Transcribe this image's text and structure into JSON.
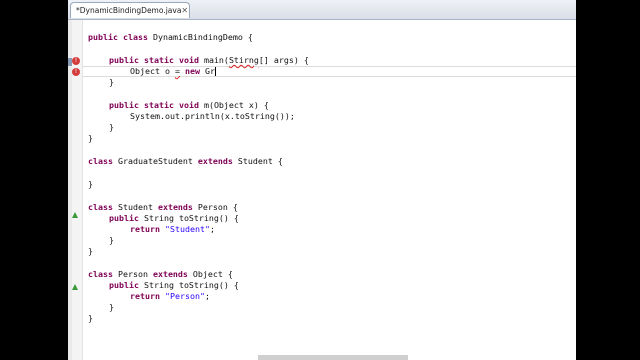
{
  "tab": {
    "title": "*DynamicBindingDemo.java",
    "close": "✕"
  },
  "code": {
    "l1": "public class DynamicBindingDemo {",
    "l3a": "public static void main(",
    "l3b": "Stirng",
    "l3c": "[] args) {",
    "l4a": "Object o ",
    "l4b": "=",
    "l4c": " new Gr",
    "l5": "}",
    "l7": "public static void m(Object x) {",
    "l8": "System.out.println(x.toString());",
    "l9": "}",
    "l10": "}",
    "l12": "class GraduateStudent extends Student {",
    "l14": "}",
    "l16": "class Student extends Person {",
    "l17": "public String toString() {",
    "l18": "return \"Student\";",
    "l19": "}",
    "l20": "}",
    "l22": "class Person extends Object {",
    "l23": "public String toString() {",
    "l24": "return \"Person\";",
    "l25": "}",
    "l26": "}"
  },
  "markers": {
    "error1_icon": "error-icon",
    "error2_icon": "error-icon",
    "override_icon": "override-triangle-icon"
  }
}
